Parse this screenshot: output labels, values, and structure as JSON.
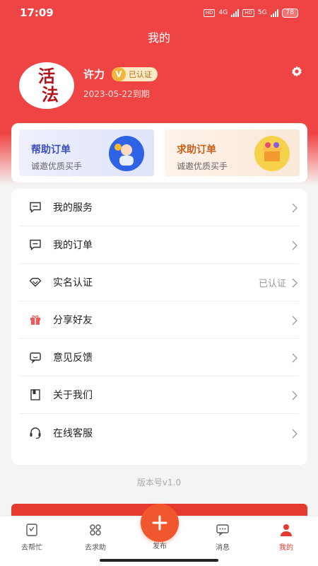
{
  "status_bar": {
    "time": "17:09",
    "battery": "78",
    "net1": "4G",
    "net2": "5G",
    "hd": "HD"
  },
  "page_title": "我的",
  "profile": {
    "avatar_chars_top": "活",
    "avatar_chars_bottom": "法",
    "name": "许力",
    "verify_badge_v": "V",
    "verify_badge": "已认证",
    "expire": "2023-05-22到期"
  },
  "promos": [
    {
      "title": "帮助订单",
      "subtitle": "诚邀优质买手"
    },
    {
      "title": "求助订单",
      "subtitle": "诚邀优质买手"
    }
  ],
  "menu": [
    {
      "label": "我的服务",
      "value": "",
      "icon": "service-icon"
    },
    {
      "label": "我的订单",
      "value": "",
      "icon": "order-icon"
    },
    {
      "label": "实名认证",
      "value": "已认证",
      "icon": "diamond-icon"
    },
    {
      "label": "分享好友",
      "value": "",
      "icon": "gift-icon"
    },
    {
      "label": "意见反馈",
      "value": "",
      "icon": "feedback-icon"
    },
    {
      "label": "关于我们",
      "value": "",
      "icon": "book-icon"
    },
    {
      "label": "在线客服",
      "value": "",
      "icon": "headset-icon"
    }
  ],
  "version": "版本号v1.0",
  "tabs": [
    {
      "label": "去帮忙"
    },
    {
      "label": "去求助"
    },
    {
      "label": "发布"
    },
    {
      "label": "消息"
    },
    {
      "label": "我的"
    }
  ],
  "colors": {
    "primary": "#ef4444",
    "accent": "#f0572f",
    "badge_gold": "#f3b43b"
  }
}
